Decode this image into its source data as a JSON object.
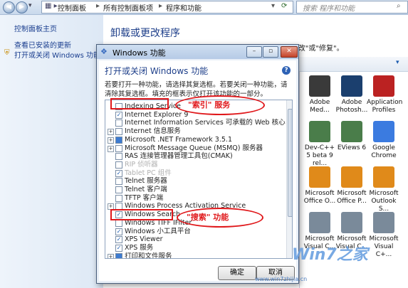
{
  "address": {
    "crumbs": [
      "控制面板",
      "所有控制面板项",
      "程序和功能"
    ],
    "search_placeholder": "搜索 程序和功能"
  },
  "left_nav": {
    "items": [
      "控制面板主页",
      "查看已安装的更新",
      "打开或关闭 Windows 功能"
    ]
  },
  "main": {
    "title": "卸载或更改程序",
    "description": "若要卸载程序，请从列表中将其选中，然后单击\"卸载\"、\"更改\"或\"修复\"。"
  },
  "programs": [
    {
      "name": "Adobe Med...",
      "icon": "adobe-media-icon",
      "color": "#3a3a3a"
    },
    {
      "name": "Adobe Photosh...",
      "icon": "photoshop-icon",
      "color": "#1b3f6e"
    },
    {
      "name": "Application Profiles",
      "icon": "application-profiles-icon",
      "color": "#b22"
    },
    {
      "name": "Dev-C++ 5 beta 9 rel...",
      "icon": "devcpp-icon",
      "color": "#4a7d4a"
    },
    {
      "name": "EViews 6",
      "icon": "eviews-icon",
      "color": "#4a7d4a"
    },
    {
      "name": "Google Chrome",
      "icon": "chrome-icon",
      "color": "#3b7be0"
    },
    {
      "name": "Microsoft Office O...",
      "icon": "office-icon",
      "color": "#e08a1a"
    },
    {
      "name": "Microsoft Office P...",
      "icon": "office-icon",
      "color": "#e08a1a"
    },
    {
      "name": "Microsoft Outlook S...",
      "icon": "office-icon",
      "color": "#e08a1a"
    },
    {
      "name": "Microsoft Visual C...",
      "icon": "installer-icon",
      "color": "#7a8a9a"
    },
    {
      "name": "Microsoft Visual C...",
      "icon": "installer-icon",
      "color": "#7a8a9a"
    },
    {
      "name": "Microsoft Visual C+...",
      "icon": "installer-icon",
      "color": "#7a8a9a"
    }
  ],
  "dialog": {
    "title": "Windows 功能",
    "heading": "打开或关闭 Windows 功能",
    "description": "若要打开一种功能，请选择其复选框。若要关闭一种功能，请清除其复选框。填充的框表示仅打开该功能的一部分。",
    "ok_label": "确定",
    "cancel_label": "取消",
    "features": [
      {
        "label": "Indexing Service",
        "state": "unchecked",
        "expandable": false
      },
      {
        "label": "Internet Explorer 9",
        "state": "checked",
        "expandable": false
      },
      {
        "label": "Internet Information Services 可承载的 Web 核心",
        "state": "unchecked",
        "expandable": false
      },
      {
        "label": "Internet 信息服务",
        "state": "unchecked",
        "expandable": true
      },
      {
        "label": "Microsoft .NET Framework 3.5.1",
        "state": "partial",
        "expandable": true
      },
      {
        "label": "Microsoft Message Queue (MSMQ) 服务器",
        "state": "unchecked",
        "expandable": true
      },
      {
        "label": "RAS 连接管理器管理工具包(CMAK)",
        "state": "unchecked",
        "expandable": false
      },
      {
        "label": "RIP 侦听器",
        "state": "unchecked",
        "expandable": false,
        "faded": true
      },
      {
        "label": "Tablet PC 组件",
        "state": "checked",
        "expandable": false,
        "faded": true
      },
      {
        "label": "Telnet 服务器",
        "state": "unchecked",
        "expandable": false
      },
      {
        "label": "Telnet 客户端",
        "state": "unchecked",
        "expandable": false
      },
      {
        "label": "TFTP 客户端",
        "state": "unchecked",
        "expandable": false
      },
      {
        "label": "Windows Process Activation Service",
        "state": "unchecked",
        "expandable": true
      },
      {
        "label": "Windows Search",
        "state": "checked",
        "expandable": false
      },
      {
        "label": "Windows TIFF IFilter",
        "state": "unchecked",
        "expandable": false
      },
      {
        "label": "Windows 小工具平台",
        "state": "checked",
        "expandable": false
      },
      {
        "label": "XPS Viewer",
        "state": "checked",
        "expandable": false
      },
      {
        "label": "XPS 服务",
        "state": "checked",
        "expandable": false
      },
      {
        "label": "打印和文件服务",
        "state": "partial",
        "expandable": true
      }
    ]
  },
  "annotations": {
    "index_label": "\"索引\" 服务",
    "search_label": "\"搜索\" 功能"
  },
  "watermark": {
    "brand": "Win7之家",
    "url": "www.win7zhijia.cn"
  }
}
